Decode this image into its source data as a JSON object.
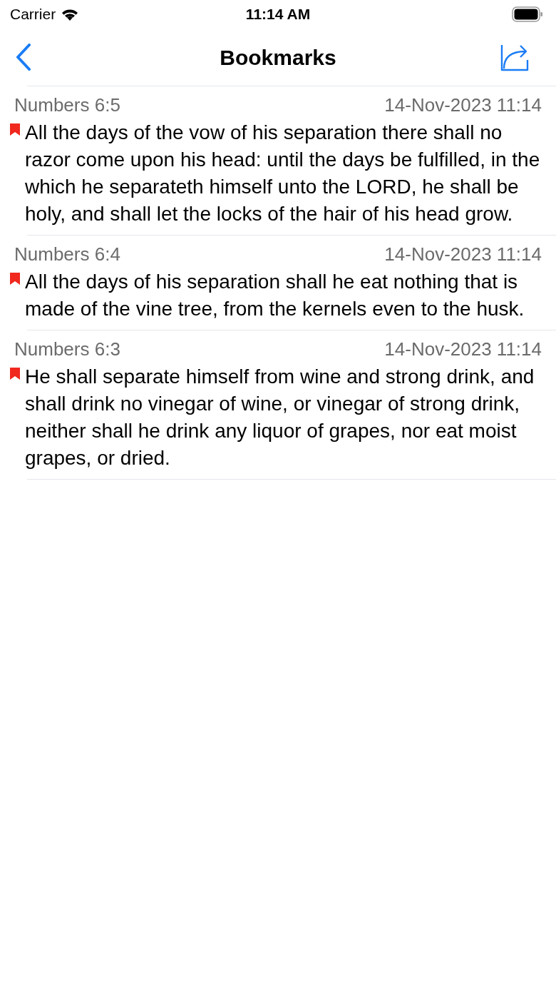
{
  "status_bar": {
    "carrier": "Carrier",
    "time": "11:14 AM"
  },
  "nav": {
    "title": "Bookmarks"
  },
  "bookmarks": [
    {
      "reference": "Numbers 6:5",
      "date": "14-Nov-2023 11:14",
      "text": "All the days of the vow of his separation there shall no razor come upon his head: until the days be fulfilled, in the which he separateth himself unto the LORD, he shall be holy, and shall let the locks of the hair of his head grow."
    },
    {
      "reference": "Numbers 6:4",
      "date": "14-Nov-2023 11:14",
      "text": "All the days of his separation shall he eat nothing that is made of the vine tree, from the kernels even to the husk."
    },
    {
      "reference": "Numbers 6:3",
      "date": "14-Nov-2023 11:14",
      "text": "He shall separate himself from wine and strong drink, and shall drink no vinegar of wine, or vinegar of strong drink, neither shall he drink any liquor of grapes, nor eat moist grapes, or dried."
    }
  ]
}
